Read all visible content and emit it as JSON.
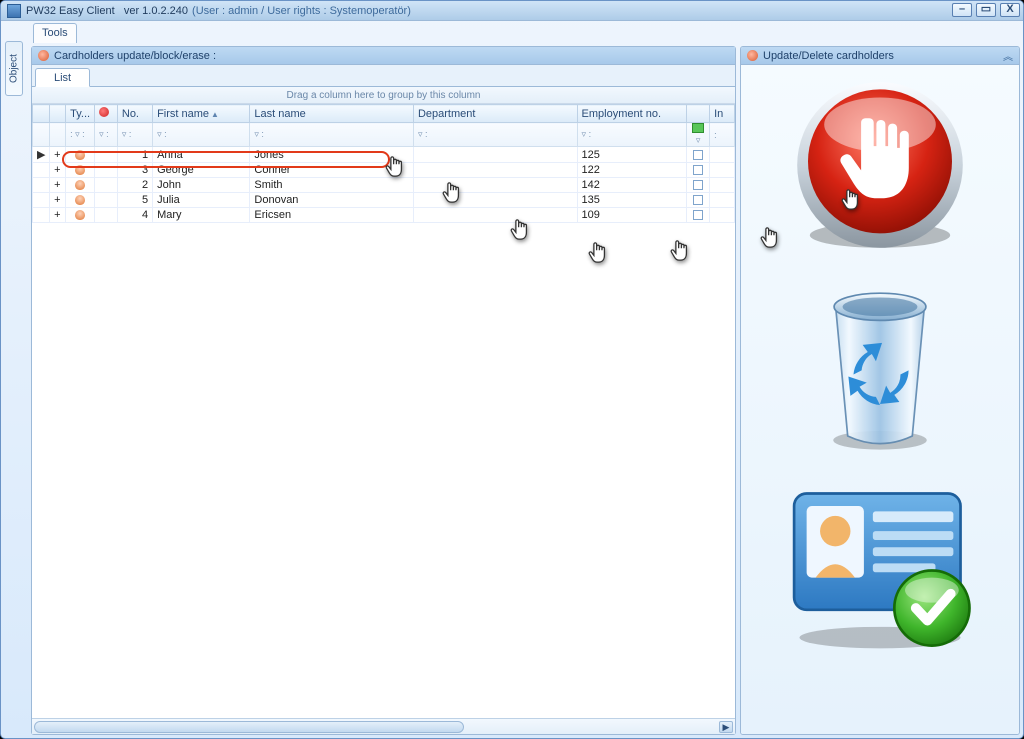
{
  "window": {
    "app_name": "PW32 Easy Client",
    "version_label": "ver 1.0.2.240",
    "user_context": "(User : admin / User rights : Systemoperatör)"
  },
  "menu": {
    "tools": "Tools"
  },
  "side_tab": {
    "object": "Object"
  },
  "left_panel": {
    "header": "Cardholders update/block/erase :",
    "tab_list": "List",
    "group_hint": "Drag a column here to group by this column",
    "columns": {
      "type": "Ty...",
      "no": "No.",
      "first_name": "First name",
      "last_name": "Last name",
      "department": "Department",
      "employment_no": "Employment no.",
      "in": "In"
    },
    "rows": [
      {
        "no": "1",
        "first": "Anna",
        "last": "Jones",
        "dept": "",
        "emp": "125"
      },
      {
        "no": "3",
        "first": "George",
        "last": "Conner",
        "dept": "",
        "emp": "122"
      },
      {
        "no": "2",
        "first": "John",
        "last": "Smith",
        "dept": "",
        "emp": "142"
      },
      {
        "no": "5",
        "first": "Julia",
        "last": "Donovan",
        "dept": "",
        "emp": "135"
      },
      {
        "no": "4",
        "first": "Mary",
        "last": "Ericsen",
        "dept": "",
        "emp": "109"
      }
    ]
  },
  "right_panel": {
    "header": "Update/Delete cardholders"
  }
}
